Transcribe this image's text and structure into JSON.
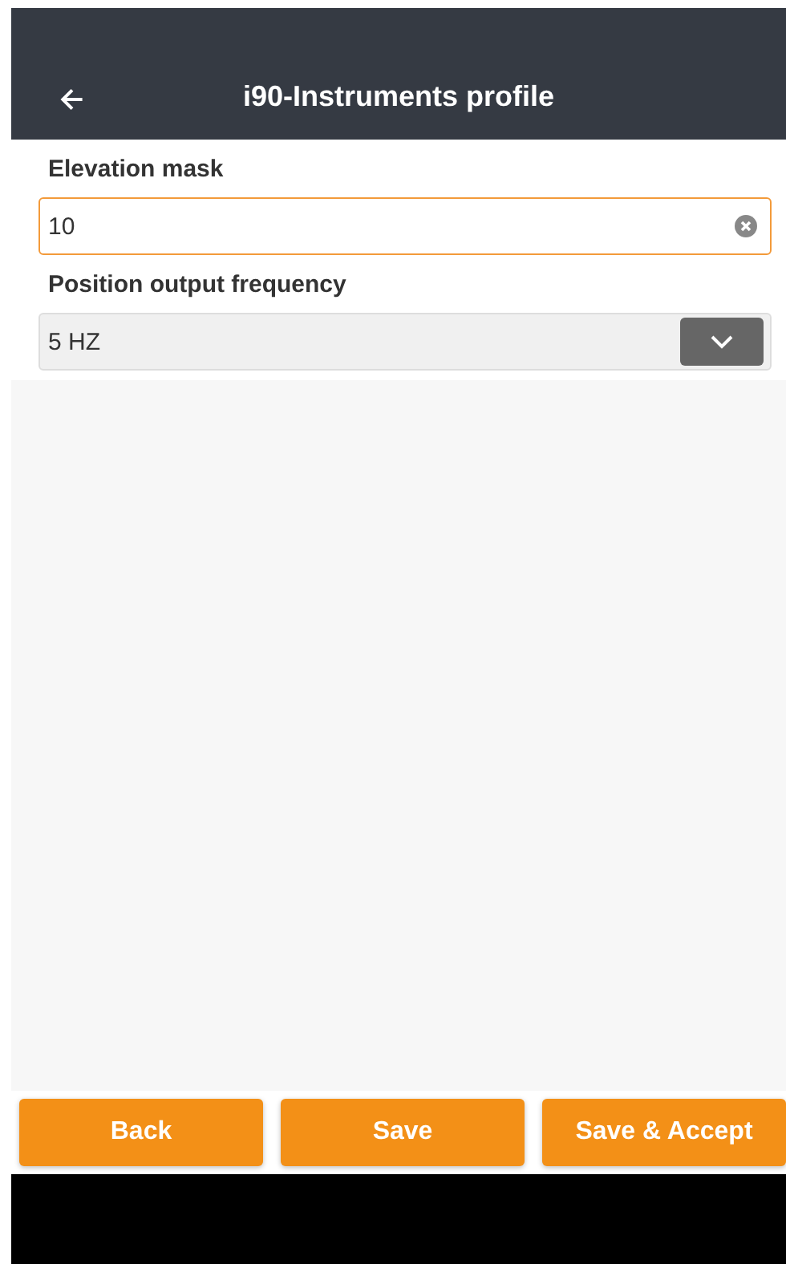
{
  "header": {
    "title": "i90-Instruments profile"
  },
  "fields": [
    {
      "kind": "text",
      "label": "Elevation mask",
      "value": "10",
      "focused": true
    },
    {
      "kind": "select",
      "label": "Position output frequency",
      "value": "5 HZ",
      "focused": false
    }
  ],
  "buttons": [
    "Back",
    "Save",
    "Save & Accept"
  ]
}
